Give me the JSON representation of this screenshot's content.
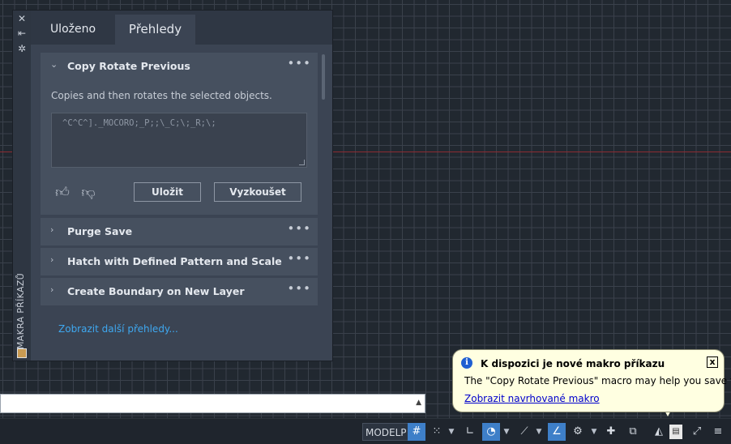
{
  "palette": {
    "side_title": "MAKRA PŘÍKAZŮ",
    "strip_icons": [
      "close-icon",
      "auto-hide-icon",
      "settings-icon"
    ],
    "tabs": [
      {
        "label": "Uloženo"
      },
      {
        "label": "Přehledy"
      }
    ],
    "active_tab": "Přehledy",
    "expanded_card": {
      "title": "Copy Rotate Previous",
      "description": "Copies and then rotates the selected objects.",
      "macro": "^C^C^]._MOCORO;_P;;\\_C;\\;_R;\\;",
      "save_label": "Uložit",
      "try_label": "Vyzkoušet"
    },
    "collapsed_cards": [
      {
        "title": "Purge Save"
      },
      {
        "title": "Hatch with Defined Pattern and Scale"
      },
      {
        "title": "Create Boundary on New Layer"
      }
    ],
    "more_link": "Zobrazit další přehledy..."
  },
  "statusbar": {
    "model_label": "MODELP"
  },
  "balloon": {
    "title": "K dispozici je nové makro příkazu",
    "message": "The \"Copy Rotate Previous\" macro may help you save time",
    "link": "Zobrazit navrhované makro",
    "close": "x"
  },
  "colors": {
    "accent": "#3e7fc8",
    "link": "#3ea8f0",
    "balloon_bg": "#ffffe1"
  }
}
